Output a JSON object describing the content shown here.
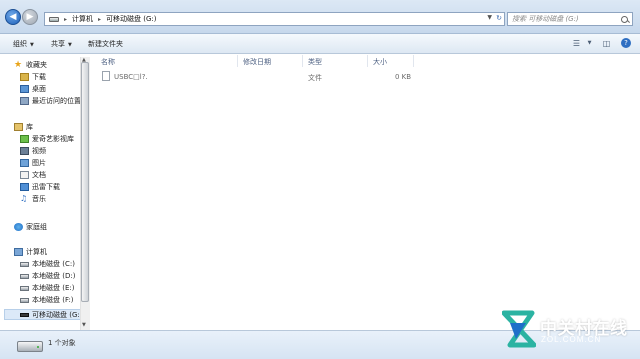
{
  "address_bar": {
    "crumbs": [
      "计算机",
      "可移动磁盘 (G:)"
    ],
    "search_placeholder": "搜索 可移动磁盘 (G:)"
  },
  "toolbar": {
    "organize_label": "组织",
    "share_label": "共享",
    "new_folder_label": "新建文件夹"
  },
  "sidebar": {
    "favorites": {
      "label": "收藏夹",
      "items": [
        "下载",
        "桌面",
        "最近访问的位置"
      ]
    },
    "libraries": {
      "label": "库",
      "items": [
        "爱奇艺影视库",
        "视频",
        "图片",
        "文档",
        "迅雷下载",
        "音乐"
      ]
    },
    "homegroup": {
      "label": "家庭组"
    },
    "computer": {
      "label": "计算机",
      "items": [
        "本地磁盘 (C:)",
        "本地磁盘 (D:)",
        "本地磁盘 (E:)",
        "本地磁盘 (F:)",
        "可移动磁盘 (G:)"
      ]
    }
  },
  "file_list": {
    "columns": [
      "名称",
      "修改日期",
      "类型",
      "大小"
    ],
    "rows": [
      {
        "name": "USBC□l?.",
        "modified": "",
        "type": "文件",
        "size": "0 KB"
      }
    ]
  },
  "status": {
    "text": "1 个对象"
  },
  "watermark": {
    "title": "中关村在线",
    "subtitle": "ZOL.COM.CN"
  },
  "colors": {
    "selection": "#dce9f8",
    "header_text": "#4d6082",
    "watermark_green": "#2bb3a2",
    "watermark_blue": "#1f6fc9"
  }
}
